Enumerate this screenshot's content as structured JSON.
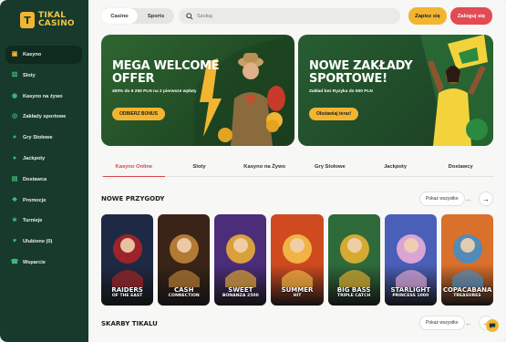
{
  "brand": {
    "line1": "TIKAL",
    "line2": "CASINO",
    "mark": "T"
  },
  "sidebar": {
    "items": [
      {
        "label": "Kasyno",
        "icon": "slot-machine-icon",
        "active": true
      },
      {
        "label": "Sloty",
        "icon": "dice-icon",
        "active": false
      },
      {
        "label": "Kasyno na żywo",
        "icon": "live-icon",
        "active": false
      },
      {
        "label": "Zakłady sportowe",
        "icon": "ball-icon",
        "active": false
      },
      {
        "label": "Gry Stołowe",
        "icon": "cards-icon",
        "active": false
      },
      {
        "label": "Jackpoty",
        "icon": "coins-icon",
        "active": false
      },
      {
        "label": "Dostawca",
        "icon": "provider-icon",
        "active": false
      },
      {
        "label": "Promocje",
        "icon": "gift-icon",
        "active": false
      },
      {
        "label": "Turnieje",
        "icon": "trophy-icon",
        "active": false
      },
      {
        "label": "Ulubione (0)",
        "icon": "heart-icon",
        "active": false
      },
      {
        "label": "Wsparcie",
        "icon": "support-icon",
        "active": false
      }
    ]
  },
  "header": {
    "toggle": [
      {
        "label": "Casino",
        "active": true
      },
      {
        "label": "Sports",
        "active": false
      }
    ],
    "search_placeholder": "Szukaj",
    "register_label": "Zapisz się",
    "login_label": "Zaloguj się"
  },
  "banners": [
    {
      "title_line1": "MEGA WELCOME",
      "title_line2": "OFFER",
      "subtitle": "400% do 6 250 PLN na 2 pierwsze wpłaty",
      "cta": "ODBIERZ BONUS"
    },
    {
      "title_line1": "NOWE ZAKŁADY",
      "title_line2": "SPORTOWE!",
      "subtitle": "Zakład bez Ryzyka do 500 PLN",
      "cta": "Obstawiaj teraz!"
    }
  ],
  "categories": [
    {
      "label": "Kasyno Online",
      "active": true
    },
    {
      "label": "Sloty",
      "active": false
    },
    {
      "label": "Kasyno na Żywo",
      "active": false
    },
    {
      "label": "Gry Stołowe",
      "active": false
    },
    {
      "label": "Jackpoty",
      "active": false
    },
    {
      "label": "Dostawcy",
      "active": false
    }
  ],
  "sections": [
    {
      "title": "NOWE PRZYGODY",
      "show_all": "Pokaż wszystko"
    },
    {
      "title": "SKARBY TIKALU",
      "show_all": "Pokaż wszystko"
    }
  ],
  "games": [
    {
      "name": "RAIDERS OF THE EAST",
      "line1": "RAIDERS",
      "line2": "OF THE EAST",
      "bg": "#1e2a45",
      "accent": "#b32323"
    },
    {
      "name": "CASH CONNECTION",
      "line1": "CASH",
      "line2": "CONNECTION",
      "bg": "#3a2417",
      "accent": "#c98a3b"
    },
    {
      "name": "SWEET BONANZA 2500",
      "line1": "SWEET",
      "line2": "BONANZA 2500",
      "bg": "#4b2d7a",
      "accent": "#f2b531"
    },
    {
      "name": "SUMMER HIT",
      "line1": "SUMMER",
      "line2": "HIT",
      "bg": "#d04a20",
      "accent": "#f7c54a"
    },
    {
      "name": "BIG BASS TRIPLE CATCH",
      "line1": "BIG BASS",
      "line2": "TRIPLE CATCH",
      "bg": "#2f6a3a",
      "accent": "#f2b531"
    },
    {
      "name": "STARLIGHT PRINCESS 1000",
      "line1": "STARLIGHT",
      "line2": "PRINCESS 1000",
      "bg": "#4a5fb8",
      "accent": "#f2b2d8"
    },
    {
      "name": "COPACABANA TREASURES",
      "line1": "COPACABANA",
      "line2": "TREASURES",
      "bg": "#d9702b",
      "accent": "#3a8fd1"
    }
  ]
}
